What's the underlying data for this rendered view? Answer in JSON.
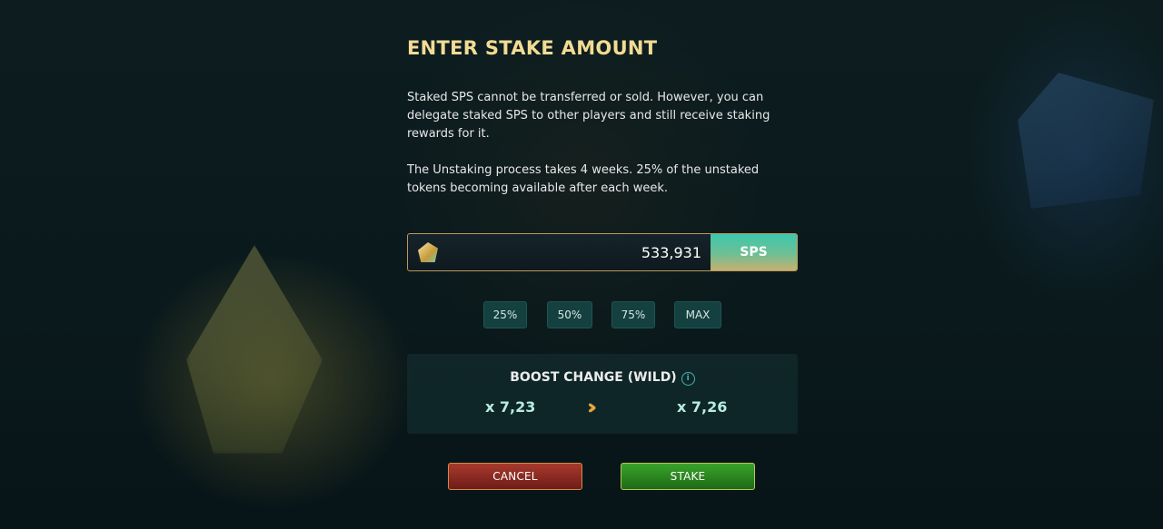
{
  "dialog": {
    "title": "ENTER STAKE AMOUNT",
    "paragraph1": "Staked SPS cannot be transferred or sold. However, you can delegate staked SPS to other players and still receive staking rewards for it.",
    "paragraph2": "The Unstaking process takes 4 weeks. 25% of the unstaked tokens becoming available after each week."
  },
  "amount": {
    "value": "533,931",
    "unit": "SPS",
    "icon": "sps-token-icon"
  },
  "percent_buttons": [
    {
      "label": "25%"
    },
    {
      "label": "50%"
    },
    {
      "label": "75%"
    },
    {
      "label": "MAX"
    }
  ],
  "boost": {
    "label": "BOOST CHANGE (WILD)",
    "info_icon": "i",
    "from": "x 7,23",
    "arrows": "›››",
    "to": "x 7,26"
  },
  "actions": {
    "cancel": "CANCEL",
    "stake": "STAKE"
  },
  "colors": {
    "title": "#f2dc93",
    "boost_value": "#b8ece0",
    "arrows": "#e6a43a",
    "cancel": "#8a2a22",
    "stake": "#2e8c20",
    "unit_tag": "#3cc8ae"
  }
}
